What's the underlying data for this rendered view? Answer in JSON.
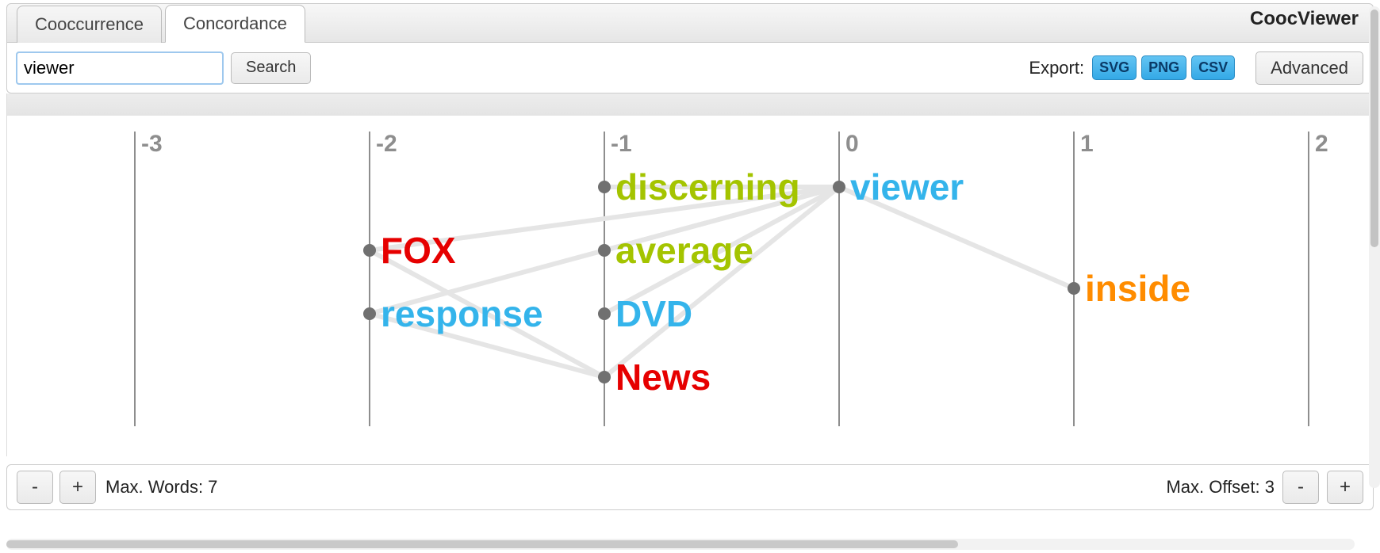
{
  "app": {
    "title": "CoocViewer"
  },
  "tabs": [
    {
      "label": "Cooccurrence",
      "active": false
    },
    {
      "label": "Concordance",
      "active": true
    }
  ],
  "toolbar": {
    "search_value": "viewer",
    "search_button": "Search",
    "export_label": "Export:",
    "export_buttons": [
      "SVG",
      "PNG",
      "CSV"
    ],
    "advanced_button": "Advanced"
  },
  "bottom": {
    "minus": "-",
    "plus": "+",
    "max_words_label": "Max. Words: 7",
    "max_offset_label": "Max. Offset: 3"
  },
  "chart_data": {
    "type": "scatter",
    "title": "",
    "xlabel": "",
    "ylabel": "",
    "x_ticks": [
      -3,
      -2,
      -1,
      0,
      1,
      2
    ],
    "x_range": [
      -3.4,
      2.6
    ],
    "rows": [
      1,
      2,
      3,
      4
    ],
    "nodes": [
      {
        "word": "FOX",
        "offset": -2,
        "row": 2,
        "color": "#e60000"
      },
      {
        "word": "response",
        "offset": -2,
        "row": 3,
        "color": "#34b4eb"
      },
      {
        "word": "discerning",
        "offset": -1,
        "row": 1,
        "color": "#a4c400"
      },
      {
        "word": "average",
        "offset": -1,
        "row": 2,
        "color": "#a4c400"
      },
      {
        "word": "DVD",
        "offset": -1,
        "row": 3,
        "color": "#34b4eb"
      },
      {
        "word": "News",
        "offset": -1,
        "row": 4,
        "color": "#e60000"
      },
      {
        "word": "viewer",
        "offset": 0,
        "row": 1,
        "color": "#34b4eb"
      },
      {
        "word": "inside",
        "offset": 1,
        "row": 2.6,
        "color": "#ff8c00"
      }
    ],
    "edges": [
      {
        "from": "FOX",
        "to": "News"
      },
      {
        "from": "FOX",
        "to": "viewer"
      },
      {
        "from": "response",
        "to": "News"
      },
      {
        "from": "response",
        "to": "viewer"
      },
      {
        "from": "discerning",
        "to": "viewer"
      },
      {
        "from": "average",
        "to": "viewer"
      },
      {
        "from": "DVD",
        "to": "viewer"
      },
      {
        "from": "News",
        "to": "viewer"
      },
      {
        "from": "viewer",
        "to": "inside"
      }
    ]
  }
}
